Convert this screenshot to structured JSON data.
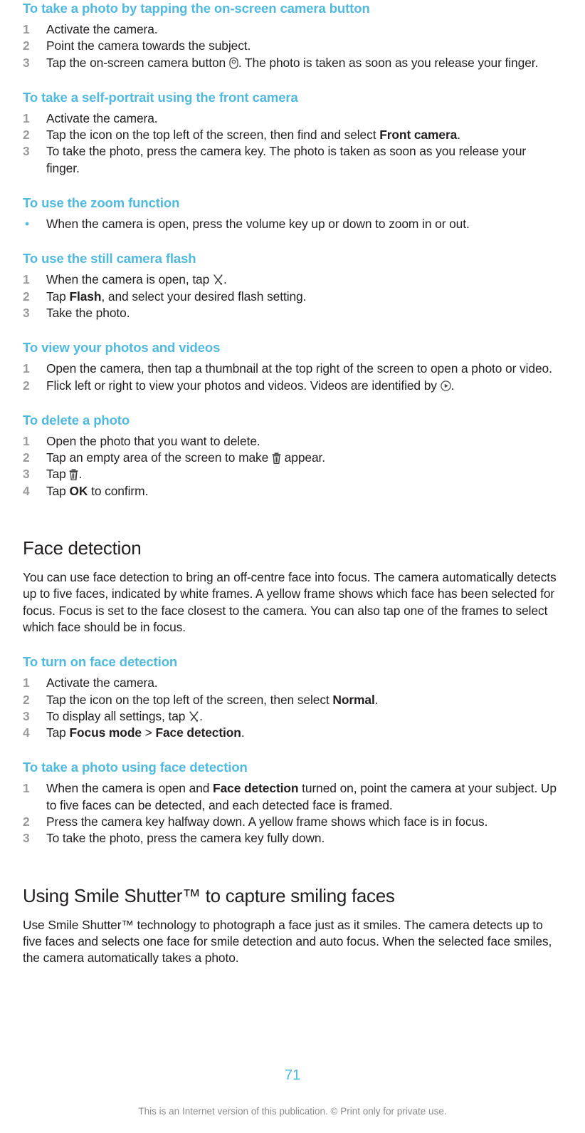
{
  "document": {
    "page_number": "71",
    "footer_note": "This is an Internet version of this publication. © Print only for private use.",
    "accent_color": "#4fb9e0",
    "text_color": "#231f20",
    "number_color": "#9b9b9b"
  },
  "sections": {
    "s1": {
      "heading": "To take a photo by tapping the on-screen camera button",
      "steps": [
        {
          "num": "1",
          "parts": [
            {
              "t": "text",
              "v": "Activate the camera."
            }
          ]
        },
        {
          "num": "2",
          "parts": [
            {
              "t": "text",
              "v": "Point the camera towards the subject."
            }
          ]
        },
        {
          "num": "3",
          "parts": [
            {
              "t": "text",
              "v": "Tap the on-screen camera button "
            },
            {
              "t": "icon",
              "v": "camera-button-icon"
            },
            {
              "t": "text",
              "v": ". The photo is taken as soon as you release your finger."
            }
          ]
        }
      ]
    },
    "s2": {
      "heading": "To take a self-portrait using the front camera",
      "steps": [
        {
          "num": "1",
          "parts": [
            {
              "t": "text",
              "v": "Activate the camera."
            }
          ]
        },
        {
          "num": "2",
          "parts": [
            {
              "t": "text",
              "v": "Tap the icon on the top left of the screen, then find and select "
            },
            {
              "t": "bold",
              "v": "Front camera"
            },
            {
              "t": "text",
              "v": "."
            }
          ]
        },
        {
          "num": "3",
          "parts": [
            {
              "t": "text",
              "v": "To take the photo, press the camera key. The photo is taken as soon as you release your finger."
            }
          ]
        }
      ]
    },
    "s3": {
      "heading": "To use the zoom function",
      "bullets": [
        {
          "bullet": "•",
          "parts": [
            {
              "t": "text",
              "v": "When the camera is open, press the volume key up or down to zoom in or out."
            }
          ]
        }
      ]
    },
    "s4": {
      "heading": "To use the still camera flash",
      "steps": [
        {
          "num": "1",
          "parts": [
            {
              "t": "text",
              "v": "When the camera is open, tap "
            },
            {
              "t": "icon",
              "v": "settings-tools-icon"
            },
            {
              "t": "text",
              "v": "."
            }
          ]
        },
        {
          "num": "2",
          "parts": [
            {
              "t": "text",
              "v": "Tap "
            },
            {
              "t": "bold",
              "v": "Flash"
            },
            {
              "t": "text",
              "v": ", and select your desired flash setting."
            }
          ]
        },
        {
          "num": "3",
          "parts": [
            {
              "t": "text",
              "v": "Take the photo."
            }
          ]
        }
      ]
    },
    "s5": {
      "heading": "To view your photos and videos",
      "steps": [
        {
          "num": "1",
          "parts": [
            {
              "t": "text",
              "v": "Open the camera, then tap a thumbnail at the top right of the screen to open a photo or video."
            }
          ]
        },
        {
          "num": "2",
          "parts": [
            {
              "t": "text",
              "v": "Flick left or right to view your photos and videos. Videos are identified by "
            },
            {
              "t": "icon",
              "v": "play-circle-icon"
            },
            {
              "t": "text",
              "v": "."
            }
          ]
        }
      ]
    },
    "s6": {
      "heading": "To delete a photo",
      "steps": [
        {
          "num": "1",
          "parts": [
            {
              "t": "text",
              "v": "Open the photo that you want to delete."
            }
          ]
        },
        {
          "num": "2",
          "parts": [
            {
              "t": "text",
              "v": "Tap an empty area of the screen to make "
            },
            {
              "t": "icon",
              "v": "trash-icon"
            },
            {
              "t": "text",
              "v": " appear."
            }
          ]
        },
        {
          "num": "3",
          "parts": [
            {
              "t": "text",
              "v": "Tap "
            },
            {
              "t": "icon",
              "v": "trash-icon"
            },
            {
              "t": "text",
              "v": "."
            }
          ]
        },
        {
          "num": "4",
          "parts": [
            {
              "t": "text",
              "v": "Tap "
            },
            {
              "t": "bold",
              "v": "OK"
            },
            {
              "t": "text",
              "v": " to confirm."
            }
          ]
        }
      ]
    },
    "s7": {
      "heading": "Face detection",
      "paragraph": "You can use face detection to bring an off-centre face into focus. The camera automatically detects up to five faces, indicated by white frames. A yellow frame shows which face has been selected for focus. Focus is set to the face closest to the camera. You can also tap one of the frames to select which face should be in focus."
    },
    "s8": {
      "heading": "To turn on face detection",
      "steps": [
        {
          "num": "1",
          "parts": [
            {
              "t": "text",
              "v": "Activate the camera."
            }
          ]
        },
        {
          "num": "2",
          "parts": [
            {
              "t": "text",
              "v": "Tap the icon on the top left of the screen, then select "
            },
            {
              "t": "bold",
              "v": "Normal"
            },
            {
              "t": "text",
              "v": "."
            }
          ]
        },
        {
          "num": "3",
          "parts": [
            {
              "t": "text",
              "v": "To display all settings, tap "
            },
            {
              "t": "icon",
              "v": "settings-tools-icon"
            },
            {
              "t": "text",
              "v": "."
            }
          ]
        },
        {
          "num": "4",
          "parts": [
            {
              "t": "text",
              "v": "Tap "
            },
            {
              "t": "bold",
              "v": "Focus mode"
            },
            {
              "t": "text",
              "v": " > "
            },
            {
              "t": "bold",
              "v": "Face detection"
            },
            {
              "t": "text",
              "v": "."
            }
          ]
        }
      ]
    },
    "s9": {
      "heading": "To take a photo using face detection",
      "steps": [
        {
          "num": "1",
          "parts": [
            {
              "t": "text",
              "v": "When the camera is open and "
            },
            {
              "t": "bold",
              "v": "Face detection"
            },
            {
              "t": "text",
              "v": " turned on, point the camera at your subject. Up to five faces can be detected, and each detected face is framed."
            }
          ]
        },
        {
          "num": "2",
          "parts": [
            {
              "t": "text",
              "v": "Press the camera key halfway down. A yellow frame shows which face is in focus."
            }
          ]
        },
        {
          "num": "3",
          "parts": [
            {
              "t": "text",
              "v": "To take the photo, press the camera key fully down."
            }
          ]
        }
      ]
    },
    "s10": {
      "heading": "Using Smile Shutter™ to capture smiling faces",
      "paragraph": "Use Smile Shutter™ technology to photograph a face just as it smiles. The camera detects up to five faces and selects one face for smile detection and auto focus. When the selected face smiles, the camera automatically takes a photo."
    }
  }
}
